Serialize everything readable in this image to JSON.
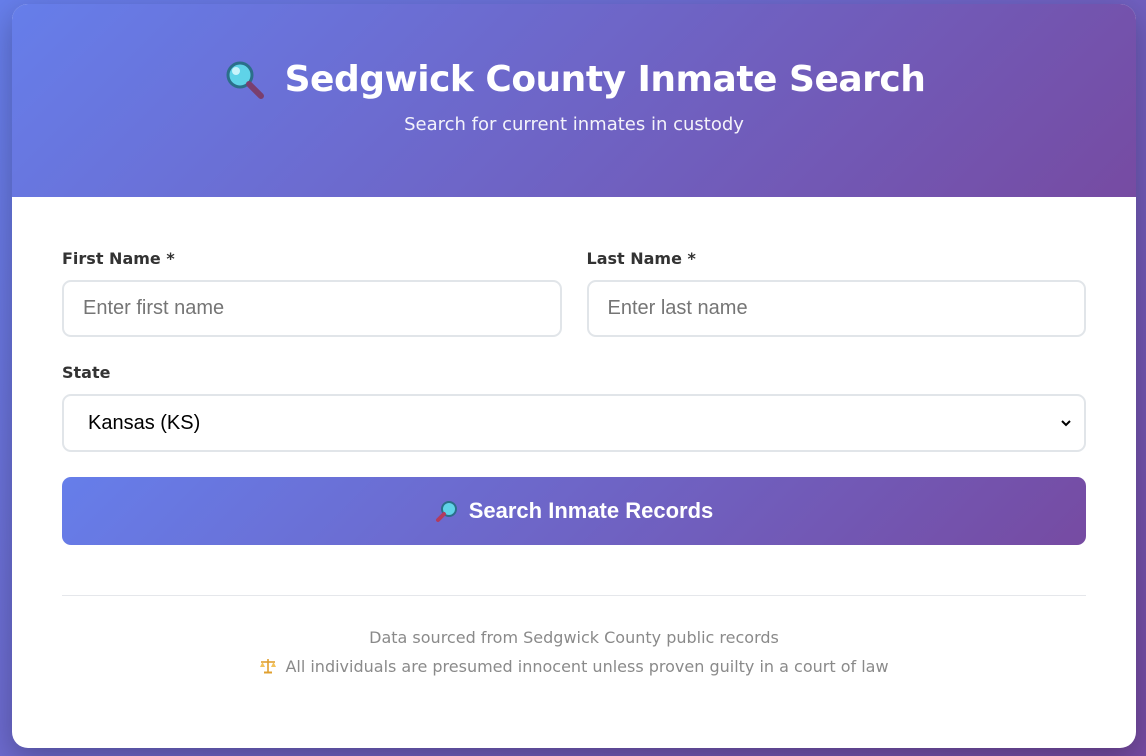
{
  "header": {
    "icon": "magnifier-icon",
    "title": "Sedgwick County Inmate Search",
    "subtitle": "Search for current inmates in custody"
  },
  "form": {
    "first_name": {
      "label": "First Name *",
      "placeholder": "Enter first name",
      "value": ""
    },
    "last_name": {
      "label": "Last Name *",
      "placeholder": "Enter last name",
      "value": ""
    },
    "state": {
      "label": "State",
      "selected": "Kansas (KS)"
    },
    "search_button": {
      "icon": "magnifier-icon",
      "label": "Search Inmate Records"
    }
  },
  "footer": {
    "source": "Data sourced from Sedgwick County public records",
    "disclaimer_icon": "scales-icon",
    "disclaimer": "All individuals are presumed innocent unless proven guilty in a court of law"
  },
  "colors": {
    "gradient_start": "#667eea",
    "gradient_end": "#764ba2",
    "label_text": "#333333",
    "footer_text": "#8a8a8a"
  }
}
